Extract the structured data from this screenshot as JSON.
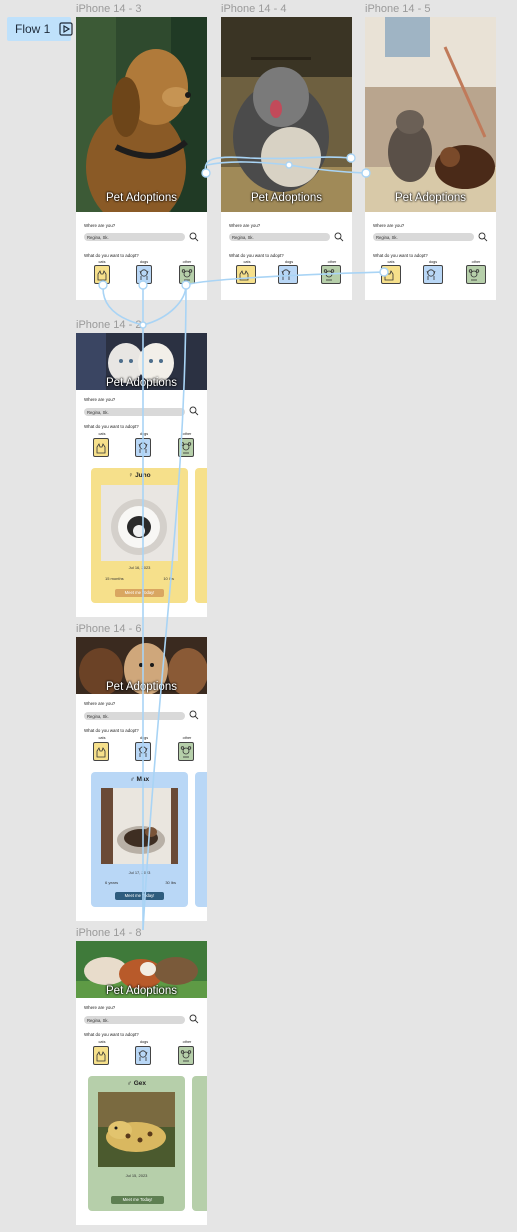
{
  "flow_label": "Flow 1",
  "frames": {
    "f3": "iPhone 14 - 3",
    "f4": "iPhone 14 - 4",
    "f5": "iPhone 14 - 5",
    "f2": "iPhone 14 - 2",
    "f6": "iPhone 14 - 6",
    "f8": "iPhone 14 - 8"
  },
  "app_title": "Pet Adoptions",
  "where_question": "Where are you?",
  "location_value": "Regina, Sk.",
  "adopt_question": "What do you want to adopt?",
  "categories": {
    "cats": "cats",
    "dogs": "dogs",
    "other": "other"
  },
  "colors": {
    "cats": "#f6e08b",
    "dogs": "#b9d7f6",
    "other": "#b6cfaa",
    "wire": "#a9d4f5"
  },
  "cards": {
    "juno": {
      "name": "♀ Juno",
      "date": "Jul 16, 2023",
      "age": "15 months",
      "weight": "10 lbs",
      "button": "Meet me Today!"
    },
    "max": {
      "name": "♂ Max",
      "date": "Jul 17, 2023",
      "age": "6 years",
      "weight": "30 lbs",
      "button": "Meet me Today!"
    },
    "gex": {
      "name": "♂ Gex",
      "date": "Jul 15, 2023",
      "button": "Meet me Today!"
    }
  }
}
